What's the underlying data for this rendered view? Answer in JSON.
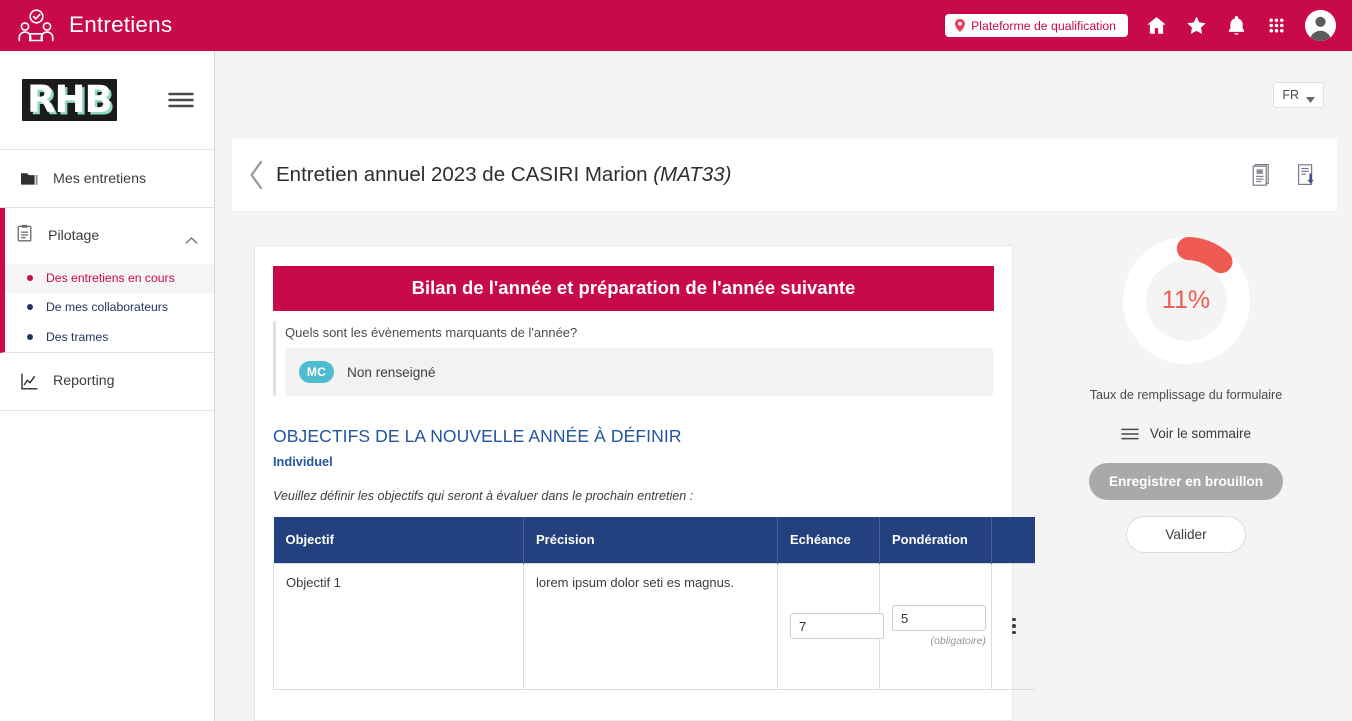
{
  "topbar": {
    "app_title": "Entretiens",
    "app_icon": "interview-people-check-icon",
    "platform_chip": {
      "label": "Plateforme de qualification",
      "icon": "location-pin-icon"
    },
    "icons": [
      {
        "name": "home-icon",
        "label": "Accueil"
      },
      {
        "name": "star-icon",
        "label": "Favoris"
      },
      {
        "name": "bell-icon",
        "label": "Notifications"
      },
      {
        "name": "apps-grid-icon",
        "label": "Applications"
      }
    ],
    "avatar": {
      "name": "user-avatar",
      "label": "Profil"
    },
    "brand_color": "#c8094b"
  },
  "sidebar": {
    "logo_text": "RHB",
    "menu_icon": "hamburger-icon",
    "items": [
      {
        "label": "Mes entretiens",
        "icon": "folder-icon"
      }
    ],
    "group": {
      "label": "Pilotage",
      "icon": "clipboard-icon",
      "chevron": "chevron-up-icon",
      "expanded": true,
      "subitems": [
        {
          "label": "Des entretiens en cours",
          "active": true
        },
        {
          "label": "De mes collaborateurs",
          "active": false
        },
        {
          "label": "Des trames",
          "active": false
        }
      ]
    },
    "reporting": {
      "label": "Reporting",
      "icon": "chart-line-icon"
    },
    "active_color": "#c8094b"
  },
  "main": {
    "language": {
      "value": "FR",
      "caret": "chevron-down-icon"
    },
    "page": {
      "back_icon": "chevron-left-icon",
      "title": "Entretien annuel 2023 de CASIRI Marion ",
      "title_italic": "(MAT33)",
      "actions": [
        {
          "name": "document-preview-icon",
          "label": "Aperçu du document"
        },
        {
          "name": "document-download-icon",
          "label": "Télécharger le document"
        }
      ]
    },
    "banner": {
      "title": "Bilan de l'année et préparation de l'année suivante"
    },
    "question": {
      "text": "Quels sont les évènements marquants de l'année?",
      "answer_initials": "MC",
      "answer_text": "Non renseigné",
      "avatar_color": "#4fbcd1"
    },
    "section": {
      "title": "OBJECTIFS DE LA NOUVELLE ANNÉE À DÉFINIR",
      "subtitle": "Individuel",
      "instruction": "Veuillez définir les objectifs qui seront à évaluer dans le prochain entretien :",
      "accent_color": "#23559e"
    },
    "table": {
      "headers": [
        "Objectif",
        "Précision",
        "Echéance",
        "Pondération",
        ""
      ],
      "header_color": "#23417f",
      "rows": [
        {
          "objectif": "Objectif 1",
          "precision": "lorem ipsum dolor seti es magnus.",
          "echeance": "7",
          "ponderation": "5",
          "ponderation_hint": "(obligatoire)",
          "menu_icon": "kebab-menu-icon"
        }
      ]
    }
  },
  "side_panel": {
    "gauge": {
      "percent_label": "11%",
      "percent_value": 11,
      "caption": "Taux de remplissage du formulaire",
      "arc_color": "#ef5a52",
      "track_color": "#ffffff"
    },
    "summary_link": {
      "label": "Voir le sommaire",
      "icon": "list-lines-icon"
    },
    "buttons": {
      "draft": "Enregistrer en brouillon",
      "validate": "Valider"
    }
  }
}
